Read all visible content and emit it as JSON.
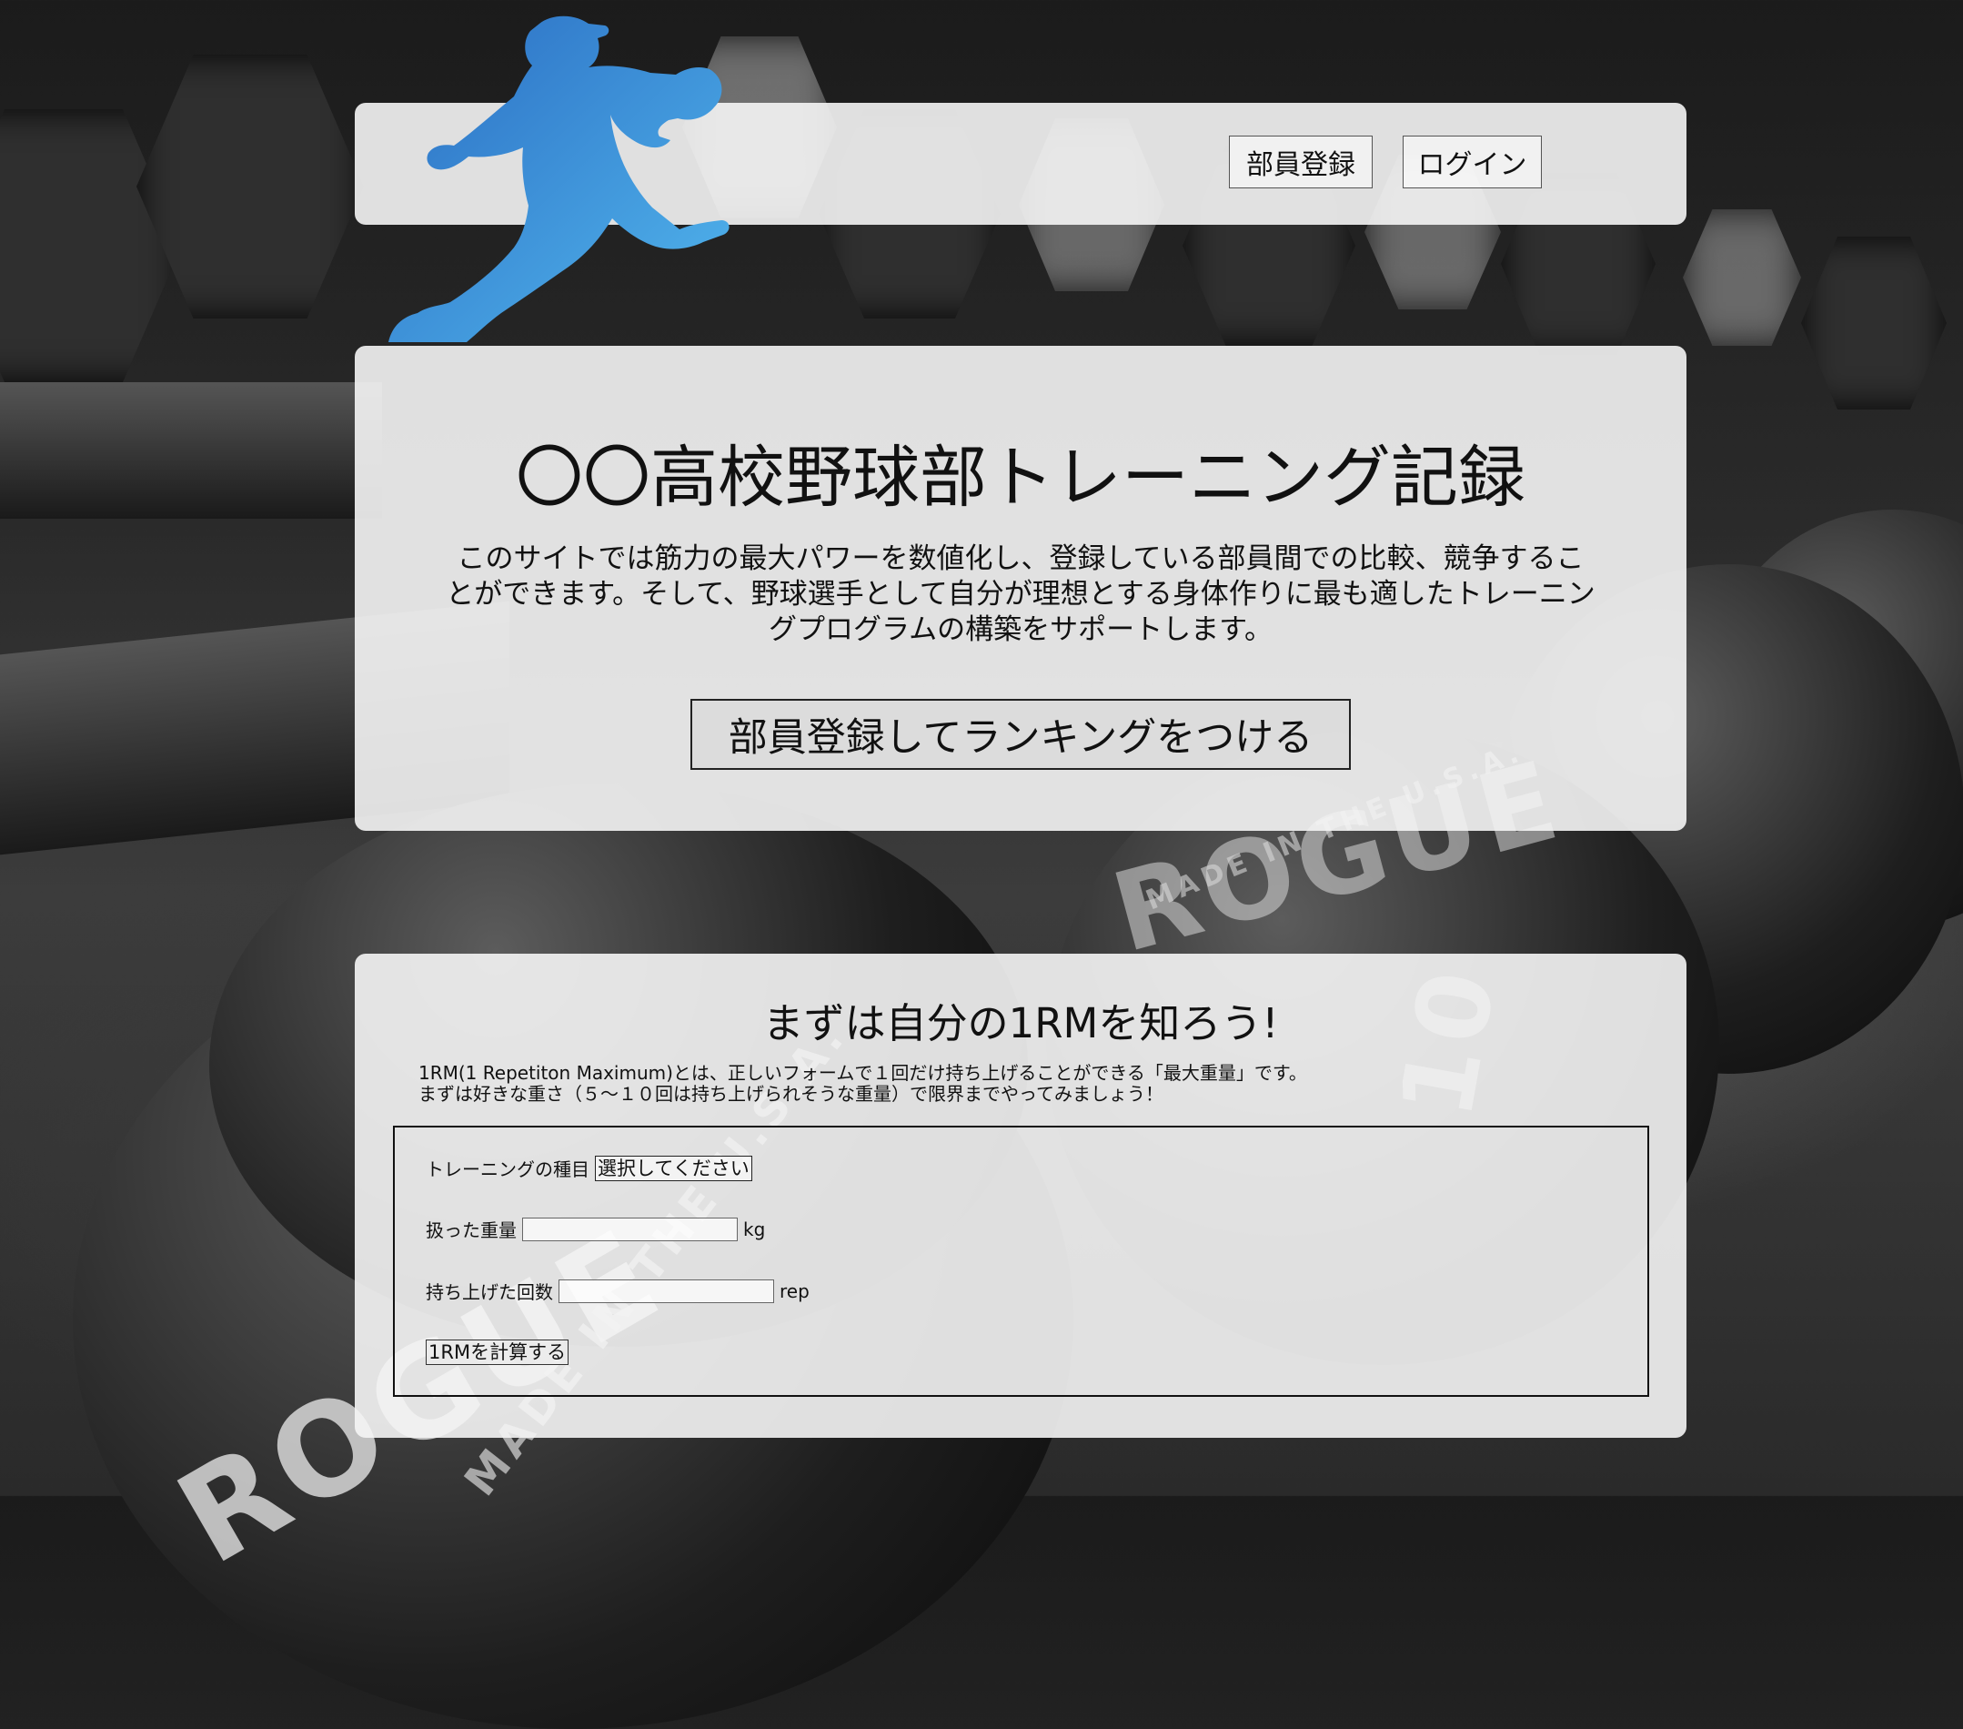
{
  "nav": {
    "register_label": "部員登録",
    "login_label": "ログイン"
  },
  "logo": {
    "icon": "baseball-pitcher-icon",
    "colors": [
      "#2f73c7",
      "#4fb3ea"
    ]
  },
  "hero": {
    "title": "〇〇高校野球部トレーニング記録",
    "description": "このサイトでは筋力の最大パワーを数値化し、登録している部員間での比較、競争することができます。そして、野球選手として自分が理想とする身体作りに最も適したトレーニングプログラムの構築をサポートします。",
    "cta_label": "部員登録してランキングをつける"
  },
  "calc": {
    "title": "まずは自分の1RMを知ろう!",
    "desc_line1": "1RM(1 Repetiton Maximum)とは、正しいフォームで１回だけ持ち上げることができる「最大重量」です。",
    "desc_line2": "まずは好きな重さ（５〜１０回は持ち上げられそうな重量）で限界までやってみましょう！",
    "type_label": "トレーニングの種目",
    "type_selected": "選択してください",
    "weight_label": "扱った重量",
    "weight_value": "",
    "weight_unit": "kg",
    "reps_label": "持ち上げた回数",
    "reps_value": "",
    "reps_unit": "rep",
    "submit_label": "1RMを計算する"
  },
  "background": {
    "ball_texts": [
      "ROGUE",
      "MADE IN THE U.S.A.",
      "10",
      "ROGUE",
      "MADE IN THE U.S.A."
    ]
  }
}
